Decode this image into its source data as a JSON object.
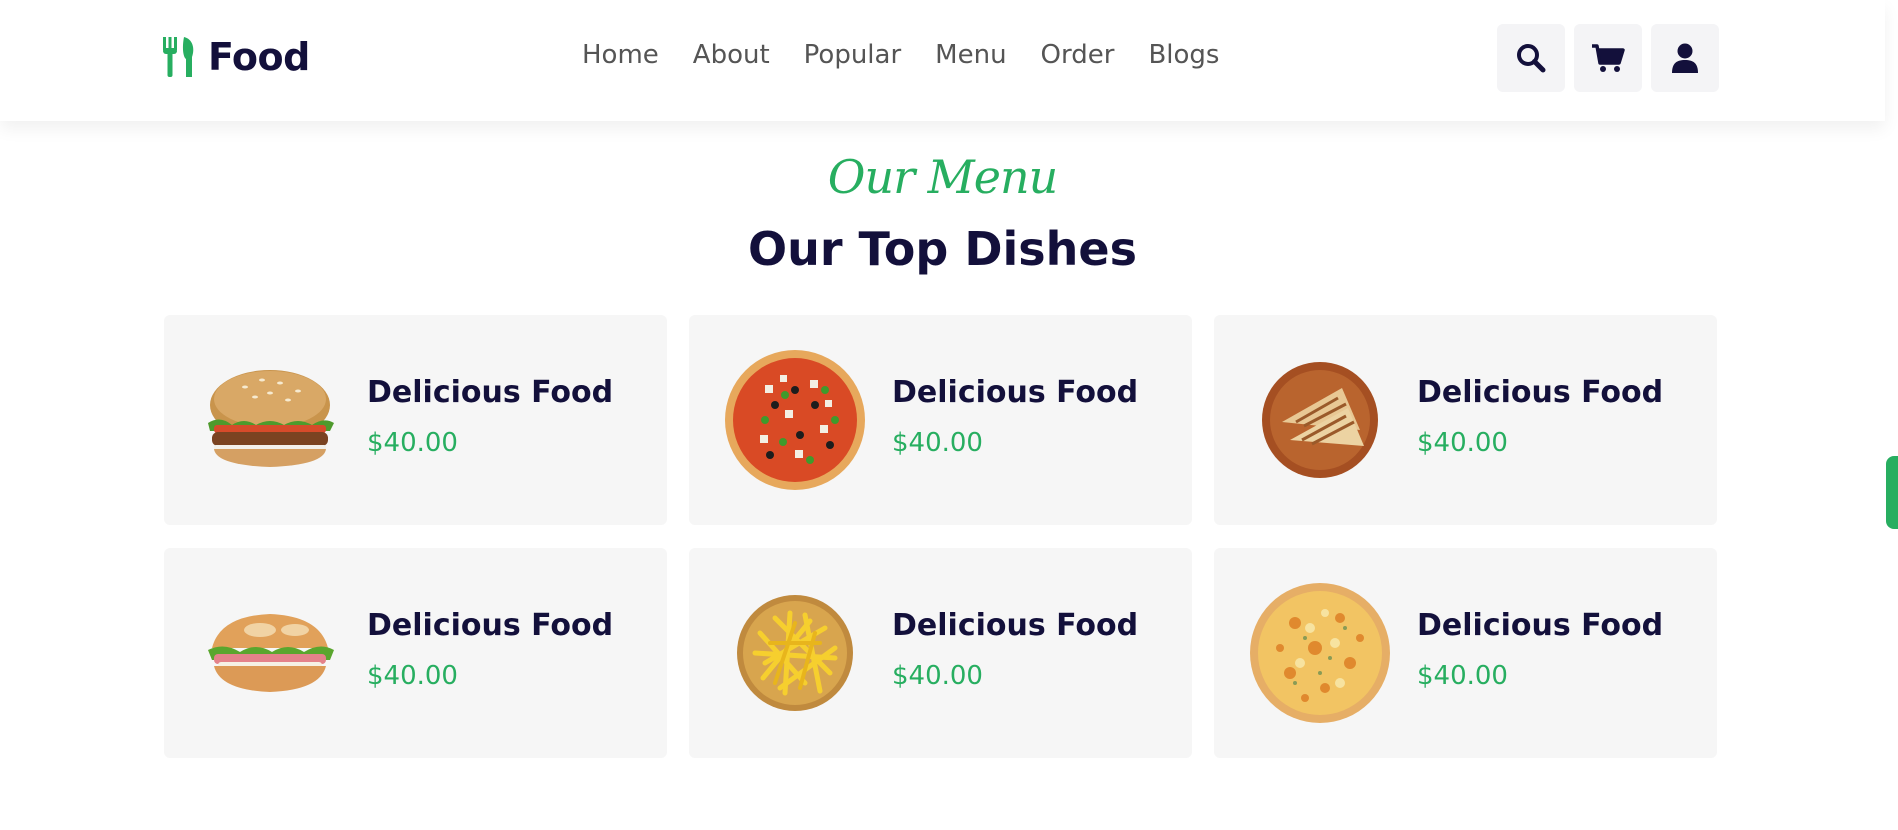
{
  "brand": {
    "name": "Food"
  },
  "nav": {
    "items": [
      "Home",
      "About",
      "Popular",
      "Menu",
      "Order",
      "Blogs"
    ]
  },
  "header_icons": [
    "search-icon",
    "cart-icon",
    "user-icon"
  ],
  "section": {
    "subtitle": "Our Menu",
    "title": "Our Top Dishes"
  },
  "dishes": [
    {
      "name": "Delicious Food",
      "price": "$40.00",
      "image": "burger"
    },
    {
      "name": "Delicious Food",
      "price": "$40.00",
      "image": "pizza-veggie"
    },
    {
      "name": "Delicious Food",
      "price": "$40.00",
      "image": "grilled-sandwich"
    },
    {
      "name": "Delicious Food",
      "price": "$40.00",
      "image": "sub-sandwich"
    },
    {
      "name": "Delicious Food",
      "price": "$40.00",
      "image": "french-fries"
    },
    {
      "name": "Delicious Food",
      "price": "$40.00",
      "image": "cheese-pizza"
    }
  ],
  "colors": {
    "accent": "#27ae60",
    "dark": "#13103b",
    "card_bg": "#f6f6f6",
    "icon_bg": "#f4f4f6"
  }
}
